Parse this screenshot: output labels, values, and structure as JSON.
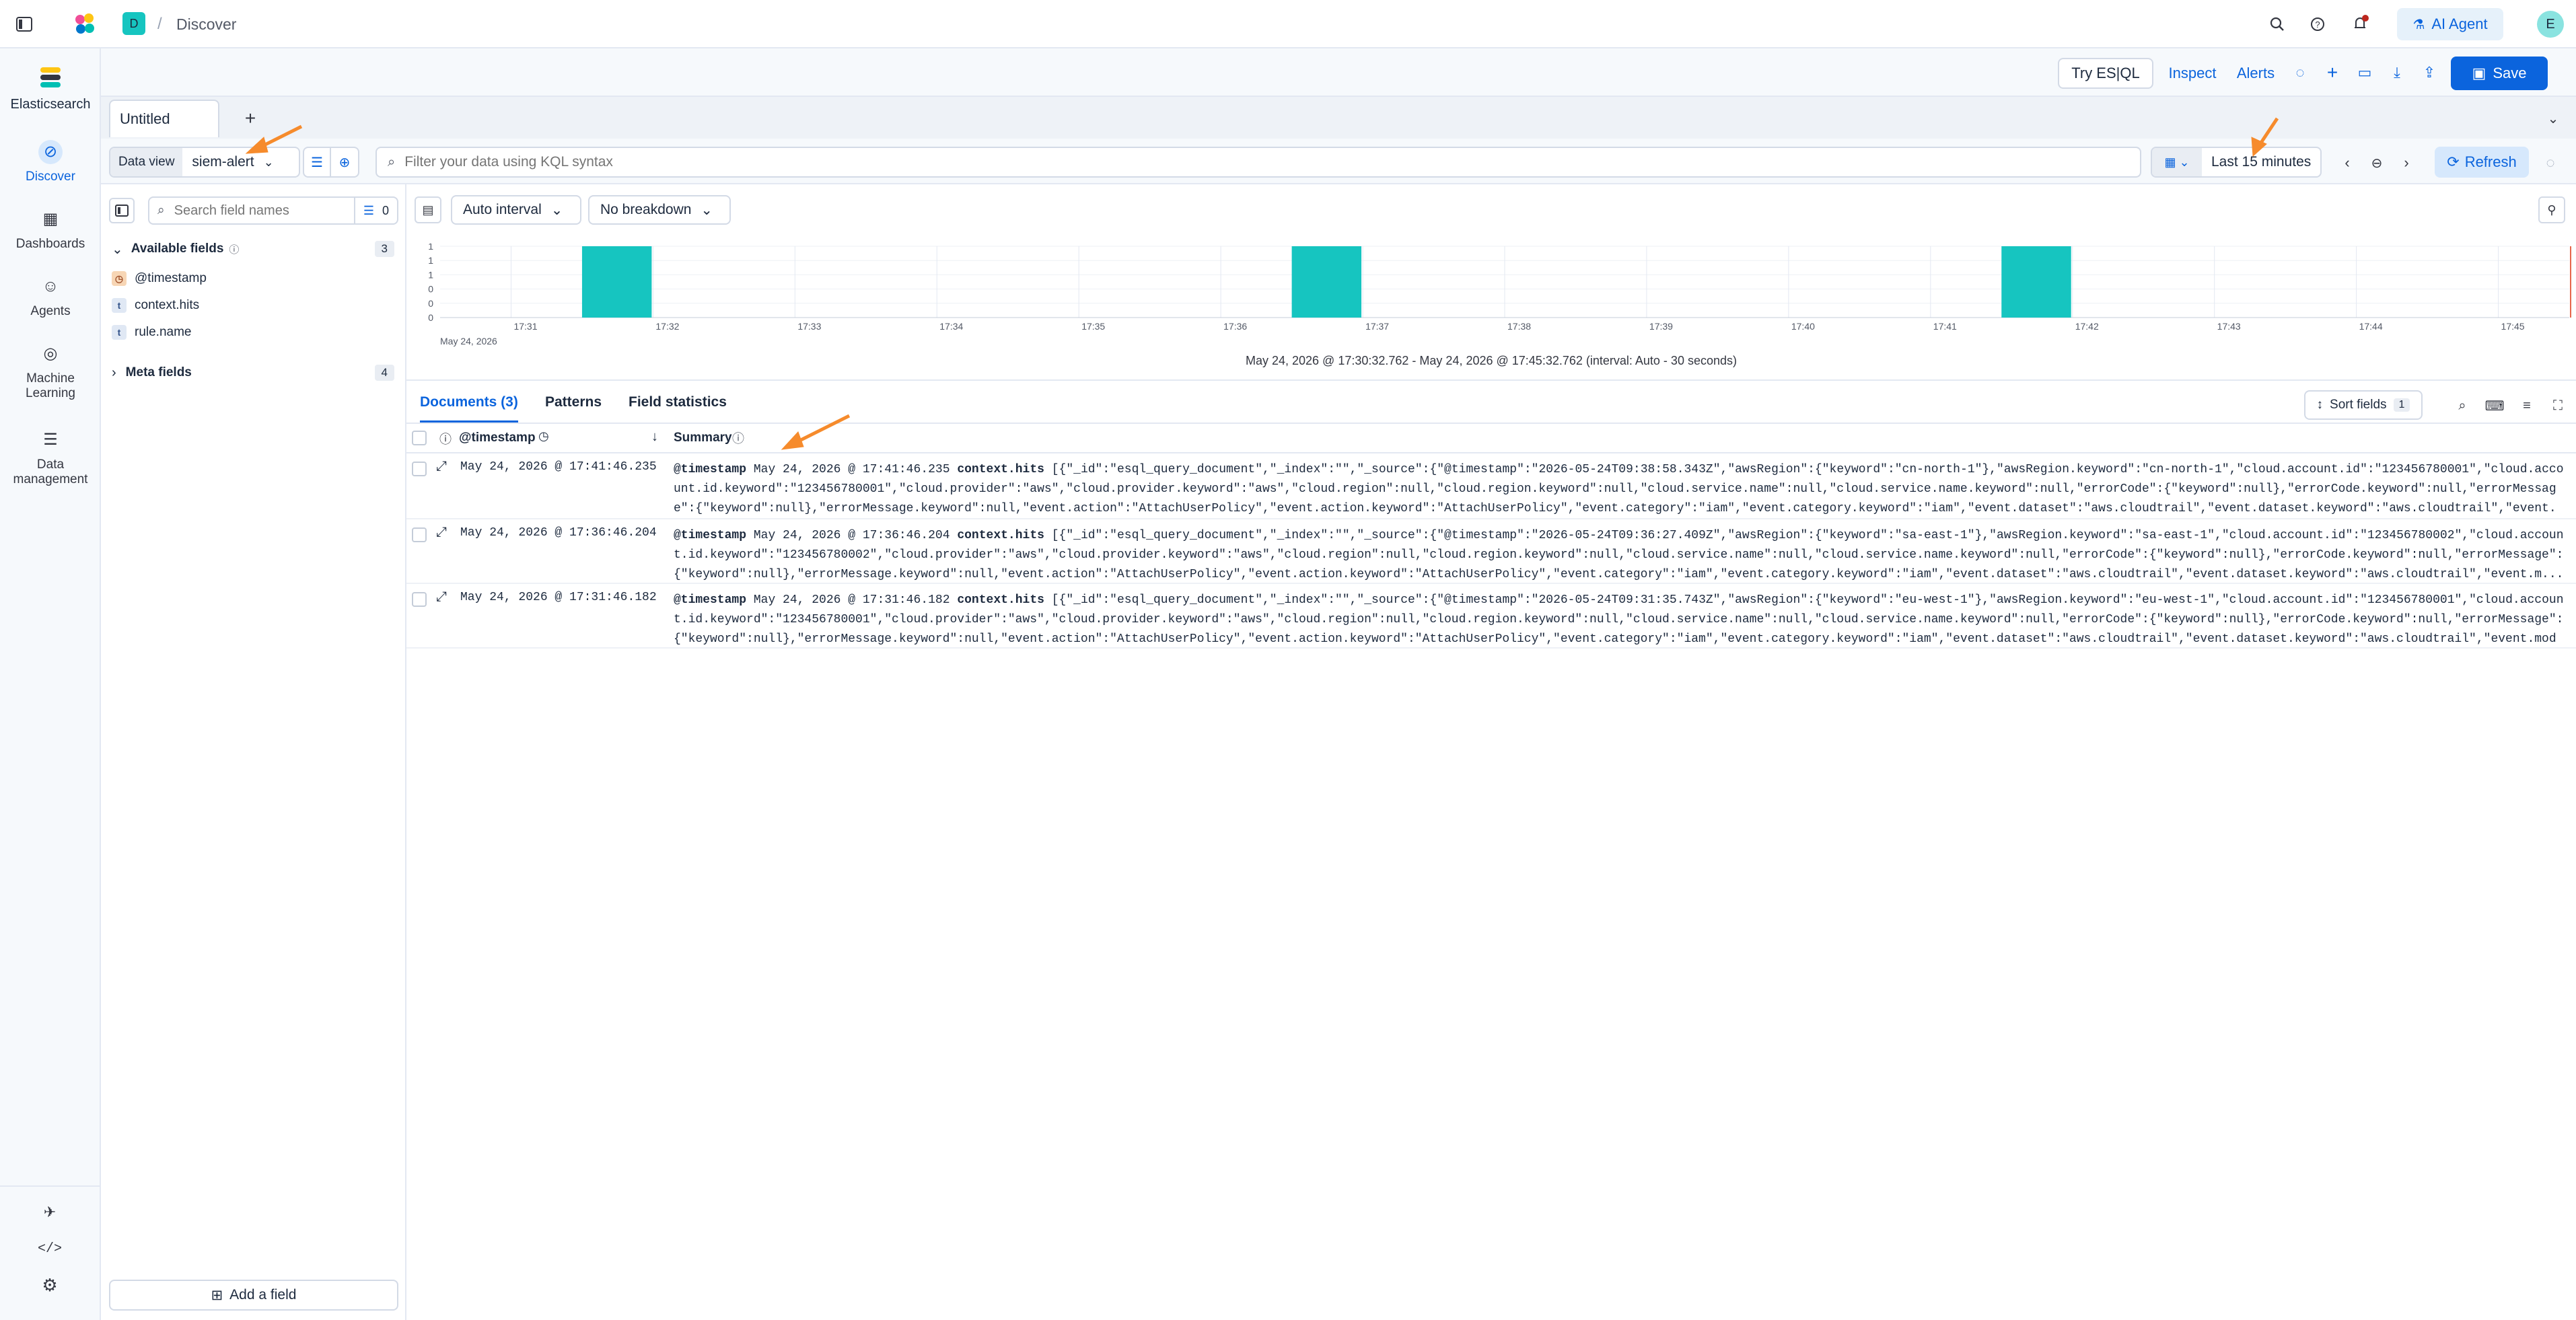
{
  "header": {
    "breadcrumb_space_initial": "D",
    "breadcrumb_sep": "/",
    "breadcrumb_page": "Discover",
    "ai_agent_label": "AI Agent",
    "user_initial": "E"
  },
  "nav": {
    "brand": "Elasticsearch",
    "items": [
      {
        "label": "Discover"
      },
      {
        "label": "Dashboards"
      },
      {
        "label": "Agents"
      },
      {
        "label": "Machine Learning"
      },
      {
        "label": "Data management"
      }
    ]
  },
  "toolbar": {
    "try_esql": "Try ES|QL",
    "inspect": "Inspect",
    "alerts": "Alerts",
    "save": "Save"
  },
  "tabs": [
    {
      "label": "Untitled"
    }
  ],
  "filter": {
    "data_view_label": "Data view",
    "data_view_value": "siem-alert",
    "search_placeholder": "Filter your data using KQL syntax",
    "time_range": "Last 15 minutes",
    "refresh": "Refresh"
  },
  "sidebar": {
    "search_placeholder": "Search field names",
    "filter_count": "0",
    "available_label": "Available fields",
    "available_count": "3",
    "fields": [
      {
        "name": "@timestamp",
        "type": "date"
      },
      {
        "name": "context.hits",
        "type": "text"
      },
      {
        "name": "rule.name",
        "type": "text"
      }
    ],
    "meta_label": "Meta fields",
    "meta_count": "4",
    "add_field": "Add a field"
  },
  "histogram": {
    "interval_label": "Auto interval",
    "breakdown_label": "No breakdown",
    "y_ticks": [
      "1",
      "1",
      "1",
      "0",
      "0",
      "0"
    ],
    "x_ticks": [
      "17:31",
      "17:32",
      "17:33",
      "17:34",
      "17:35",
      "17:36",
      "17:37",
      "17:38",
      "17:39",
      "17:40",
      "17:41",
      "17:42",
      "17:43",
      "17:44",
      "17:45"
    ],
    "date_label": "May 24, 2026",
    "range_caption": "May 24, 2026 @ 17:30:32.762 - May 24, 2026 @ 17:45:32.762 (interval: Auto - 30 seconds)",
    "bar_color": "#16c5c0"
  },
  "chart_data": {
    "type": "bar",
    "categories": [
      "17:31:30",
      "17:36:30",
      "17:41:30"
    ],
    "values": [
      1,
      1,
      1
    ],
    "ylim": [
      0,
      1
    ],
    "title": "",
    "xlabel": "",
    "ylabel": ""
  },
  "docs": {
    "tabs": [
      {
        "label": "Documents (3)"
      },
      {
        "label": "Patterns"
      },
      {
        "label": "Field statistics"
      }
    ],
    "sort_fields_label": "Sort fields",
    "sort_fields_count": "1",
    "col_timestamp": "@timestamp",
    "col_summary": "Summary",
    "rows": [
      {
        "ts": "May 24, 2026 @ 17:41:46.235",
        "k1": "@timestamp",
        "v1": "May 24, 2026 @ 17:41:46.235",
        "k2": "context.hits",
        "v2": "[{\"_id\":\"esql_query_document\",\"_index\":\"\",\"_source\":{\"@timestamp\":\"2026-05-24T09:38:58.343Z\",\"awsRegion\":{\"keyword\":\"cn-north-1\"},\"awsRegion.keyword\":\"cn-north-1\",\"cloud.account.id\":\"123456780001\",\"cloud.account.id.keyword\":\"123456780001\",\"cloud.provider\":\"aws\",\"cloud.provider.keyword\":\"aws\",\"cloud.region\":null,\"cloud.region.keyword\":null,\"cloud.service.name\":null,\"cloud.service.name.keyword\":null,\"errorCode\":{\"keyword\":null},\"errorCode.keyword\":null,\"errorMessage\":{\"keyword\":null},\"errorMessage.keyword\":null,\"event.action\":\"AttachUserPolicy\",\"event.action.keyword\":\"AttachUserPolicy\",\"event.category\":\"iam\",\"event.category.keyword\":\"iam\",\"event.dataset\":\"aws.cloudtrail\",\"event.dataset.keyword\":\"aws.cloudtrail\",\"event.m..."
      },
      {
        "ts": "May 24, 2026 @ 17:36:46.204",
        "k1": "@timestamp",
        "v1": "May 24, 2026 @ 17:36:46.204",
        "k2": "context.hits",
        "v2": "[{\"_id\":\"esql_query_document\",\"_index\":\"\",\"_source\":{\"@timestamp\":\"2026-05-24T09:36:27.409Z\",\"awsRegion\":{\"keyword\":\"sa-east-1\"},\"awsRegion.keyword\":\"sa-east-1\",\"cloud.account.id\":\"123456780002\",\"cloud.account.id.keyword\":\"123456780002\",\"cloud.provider\":\"aws\",\"cloud.provider.keyword\":\"aws\",\"cloud.region\":null,\"cloud.region.keyword\":null,\"cloud.service.name\":null,\"cloud.service.name.keyword\":null,\"errorCode\":{\"keyword\":null},\"errorCode.keyword\":null,\"errorMessage\":{\"keyword\":null},\"errorMessage.keyword\":null,\"event.action\":\"AttachUserPolicy\",\"event.action.keyword\":\"AttachUserPolicy\",\"event.category\":\"iam\",\"event.category.keyword\":\"iam\",\"event.dataset\":\"aws.cloudtrail\",\"event.dataset.keyword\":\"aws.cloudtrail\",\"event.m..."
      },
      {
        "ts": "May 24, 2026 @ 17:31:46.182",
        "k1": "@timestamp",
        "v1": "May 24, 2026 @ 17:31:46.182",
        "k2": "context.hits",
        "v2": "[{\"_id\":\"esql_query_document\",\"_index\":\"\",\"_source\":{\"@timestamp\":\"2026-05-24T09:31:35.743Z\",\"awsRegion\":{\"keyword\":\"eu-west-1\"},\"awsRegion.keyword\":\"eu-west-1\",\"cloud.account.id\":\"123456780001\",\"cloud.account.id.keyword\":\"123456780001\",\"cloud.provider\":\"aws\",\"cloud.provider.keyword\":\"aws\",\"cloud.region\":null,\"cloud.region.keyword\":null,\"cloud.service.name\":null,\"cloud.service.name.keyword\":null,\"errorCode\":{\"keyword\":null},\"errorCode.keyword\":null,\"errorMessage\":{\"keyword\":null},\"errorMessage.keyword\":null,\"event.action\":\"AttachUserPolicy\",\"event.action.keyword\":\"AttachUserPolicy\",\"event.category\":\"iam\",\"event.category.keyword\":\"iam\",\"event.dataset\":\"aws.cloudtrail\",\"event.dataset.keyword\":\"aws.cloudtrail\",\"event.modu..."
      }
    ]
  },
  "colors": {
    "accent": "#0b64dd",
    "brand_teal": "#16c5c0",
    "annotation_arrow": "#f68b2c"
  }
}
